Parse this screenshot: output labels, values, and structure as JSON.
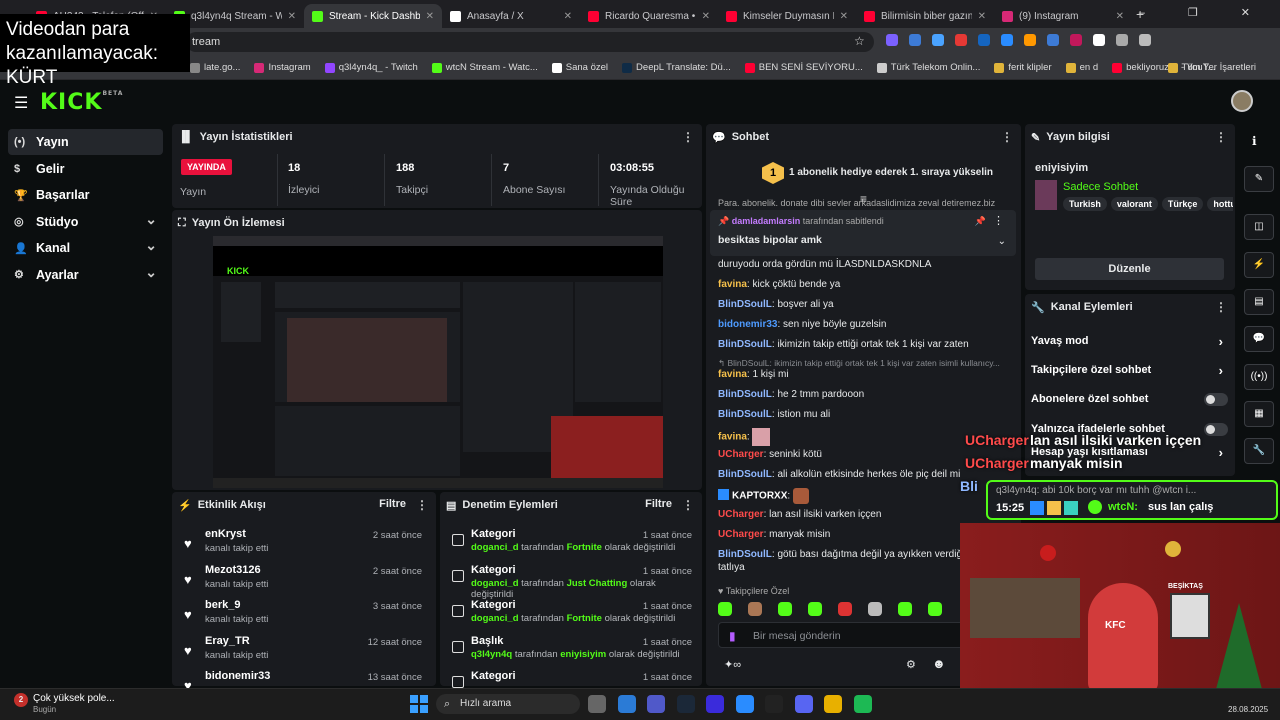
{
  "browser": {
    "tabs": [
      {
        "title": "AH343 - Telefon (Official",
        "color": "#ff0033"
      },
      {
        "title": "q3l4yn4q Stream - Watch",
        "color": "#53fc18"
      },
      {
        "title": "Stream - Kick Dashboard",
        "color": "#53fc18"
      },
      {
        "title": "Anasayfa / X",
        "color": "#ffffff"
      },
      {
        "title": "Ricardo Quaresma • Çinge",
        "color": "#ff0033"
      },
      {
        "title": "Kimseler Duymasın İçimde",
        "color": "#ff0033"
      },
      {
        "title": "Bilirmisin biber gazını - Yo",
        "color": "#ff0033"
      },
      {
        "title": "(9) Instagram",
        "color": "#d62976"
      }
    ],
    "url": "tream",
    "bookmarks": [
      "late.go...",
      "Instagram",
      "q3l4yn4q_ - Twitch",
      "wtcN Stream - Watc...",
      "Sana özel",
      "DeepL Translate: Dü...",
      "BEN SENİ SEVİYORU...",
      "Türk Telekom Onlin...",
      "ferit klipler",
      "en d",
      "bekliyoruzzz - YouT...",
      "Tüm Yer İşaretleri"
    ]
  },
  "overlay_text": "Videodan para kazanılamayacak: KÜRT",
  "logo": {
    "text": "KICK",
    "badge": "BETA"
  },
  "sidebar": {
    "items": [
      {
        "label": "Yayın",
        "icon": "broadcast-icon"
      },
      {
        "label": "Gelir",
        "icon": "money-icon"
      },
      {
        "label": "Başarılar",
        "icon": "trophy-icon"
      },
      {
        "label": "Stüdyo",
        "icon": "studio-icon"
      },
      {
        "label": "Kanal",
        "icon": "person-icon"
      },
      {
        "label": "Ayarlar",
        "icon": "gear-icon"
      }
    ]
  },
  "stats": {
    "title": "Yayın İstatistikleri",
    "live_badge": "YAYINDA",
    "live_label": "Yayın",
    "items": [
      {
        "value": "18",
        "label": "İzleyici"
      },
      {
        "value": "188",
        "label": "Takipçi"
      },
      {
        "value": "7",
        "label": "Abone Sayısı"
      },
      {
        "value": "03:08:55",
        "label": "Yayında Olduğu Süre"
      }
    ]
  },
  "preview": {
    "title": "Yayın Ön İzlemesi"
  },
  "events": {
    "title": "Etkinlik Akışı",
    "filter": "Filtre",
    "rows": [
      {
        "name": "enKryst",
        "sub": "kanalı takip etti",
        "time": "2 saat önce"
      },
      {
        "name": "Mezot3126",
        "sub": "kanalı takip etti",
        "time": "2 saat önce"
      },
      {
        "name": "berk_9",
        "sub": "kanalı takip etti",
        "time": "3 saat önce"
      },
      {
        "name": "Eray_TR",
        "sub": "kanalı takip etti",
        "time": "12 saat önce"
      },
      {
        "name": "bidonemir33",
        "sub": "",
        "time": "13 saat önce"
      }
    ]
  },
  "moderation": {
    "title": "Denetim Eylemleri",
    "filter": "Filtre",
    "rows": [
      {
        "name": "Kategori",
        "user": "doganci_d",
        "mid": " tarafından ",
        "value": "Fortnite",
        "end": " olarak değiştirildi",
        "time": "1 saat önce"
      },
      {
        "name": "Kategori",
        "user": "doganci_d",
        "mid": " tarafından ",
        "value": "Just Chatting",
        "end": " olarak değiştirildi",
        "time": "1 saat önce"
      },
      {
        "name": "Kategori",
        "user": "doganci_d",
        "mid": " tarafından ",
        "value": "Fortnite",
        "end": " olarak değiştirildi",
        "time": "1 saat önce"
      },
      {
        "name": "Başlık",
        "user": "q3l4yn4q",
        "mid": " tarafından ",
        "value": "eniyisiyim",
        "end": " olarak değiştirildi",
        "time": "1 saat önce"
      },
      {
        "name": "Kategori",
        "user": "",
        "mid": "",
        "value": "",
        "end": "",
        "time": "1 saat önce"
      }
    ]
  },
  "chat": {
    "title": "Sohbet",
    "gift_count": "1",
    "gift_text": "1 abonelik hediye ederek 1. sıraya yükselin",
    "partial_line": "Para. abonelik. donate dibi sevler arkadaslidimiza zeval detiremez.biz",
    "pinned_by": "damladamlarsin",
    "pinned_by_suffix": " tarafından sabitlendi",
    "pinned_msg": "besiktas bipolar amk",
    "messages": [
      {
        "user": "",
        "color": "#e8eaeb",
        "text": "duruyodu orda gördün mü İLASDNLDASKDNLA"
      },
      {
        "user": "favina",
        "color": "#f5c04b",
        "text": "kick çöktü bende ya"
      },
      {
        "user": "BlinDSoulL",
        "color": "#8fb8ff",
        "text": "boşver ali ya"
      },
      {
        "user": "bidonemir33",
        "color": "#4e9bff",
        "text": "sen niye böyle guzelsin"
      },
      {
        "user": "BlinDSoulL",
        "color": "#8fb8ff",
        "text": "ikimizin takip ettiği ortak tek 1 kişi var zaten"
      },
      {
        "user": "",
        "color": "#8a8d92",
        "text": "↰ BlinDSoulL: ikimizin takip ettiği ortak tek 1 kişi var zaten isimli kullanıcy..."
      },
      {
        "user": "favina",
        "color": "#f5c04b",
        "text": "1 kişi mi"
      },
      {
        "user": "BlinDSoulL",
        "color": "#8fb8ff",
        "text": "he 2 tmm pardooon"
      },
      {
        "user": "BlinDSoulL",
        "color": "#8fb8ff",
        "text": "istion mu ali"
      },
      {
        "user": "favina",
        "color": "#f5c04b",
        "text": ""
      },
      {
        "user": "UCharger",
        "color": "#ff4b4b",
        "text": "seninki kötü"
      },
      {
        "user": "BlinDSoulL",
        "color": "#8fb8ff",
        "text": "ali alkolün etkisinde herkes öle piç deil mi"
      },
      {
        "user": "KAPTORXX",
        "color": "#ffffff",
        "text": ""
      },
      {
        "user": "UCharger",
        "color": "#ff4b4b",
        "text": "lan asıl ilsiki varken iççen"
      },
      {
        "user": "UCharger",
        "color": "#ff4b4b",
        "text": "manyak misin"
      },
      {
        "user": "BlinDSoulL",
        "color": "#8fb8ff",
        "text": "götü bası dağıtma değil ya ayıkken verdiği özgü tatlıya"
      }
    ],
    "followers_only": "Takipçilere Özel",
    "input_placeholder": "Bir mesaj gönderin"
  },
  "stream_info": {
    "title": "Yayın bilgisi",
    "stream_title": "eniyisiyim",
    "category": "Sadece Sohbet",
    "tags": [
      "Turkish",
      "valorant",
      "Türkçe",
      "hottul"
    ],
    "edit_button": "Düzenle"
  },
  "channel_actions": {
    "title": "Kanal Eylemleri",
    "items": [
      {
        "label": "Yavaş mod",
        "kind": "chevron"
      },
      {
        "label": "Takipçilere özel sohbet",
        "kind": "chevron"
      },
      {
        "label": "Abonelere özel sohbet",
        "kind": "toggle"
      },
      {
        "label": "Yalnızca ifadelerle sohbet",
        "kind": "toggle"
      },
      {
        "label": "Hesap yaşı kısıtlaması",
        "kind": "chevron"
      }
    ]
  },
  "overlay_chat": {
    "lines": [
      {
        "user": "UCharger",
        "text": "lan asıl ilsiki varken iççen"
      },
      {
        "user": "UCharger",
        "text": "manyak misin"
      }
    ],
    "partial": "Bli",
    "toast_reply": "q3l4yn4q: abi 10k borç var mı tuhh @wtcn i...",
    "toast_time": "15:25",
    "toast_user": "wtcN:",
    "toast_text": "sus lan çalış"
  },
  "cam": {
    "sign": "BEŞİKTAŞ",
    "hat_text": "KFC"
  },
  "taskbar": {
    "notify_badge": "2",
    "notify_title": "Çok yüksek pole...",
    "notify_sub": "Bugün",
    "search": "Hızlı arama",
    "date": "28.08.2025"
  },
  "colors": {
    "kick_green": "#53fc18",
    "live_red": "#e9113c",
    "panel": "#191b1f"
  }
}
